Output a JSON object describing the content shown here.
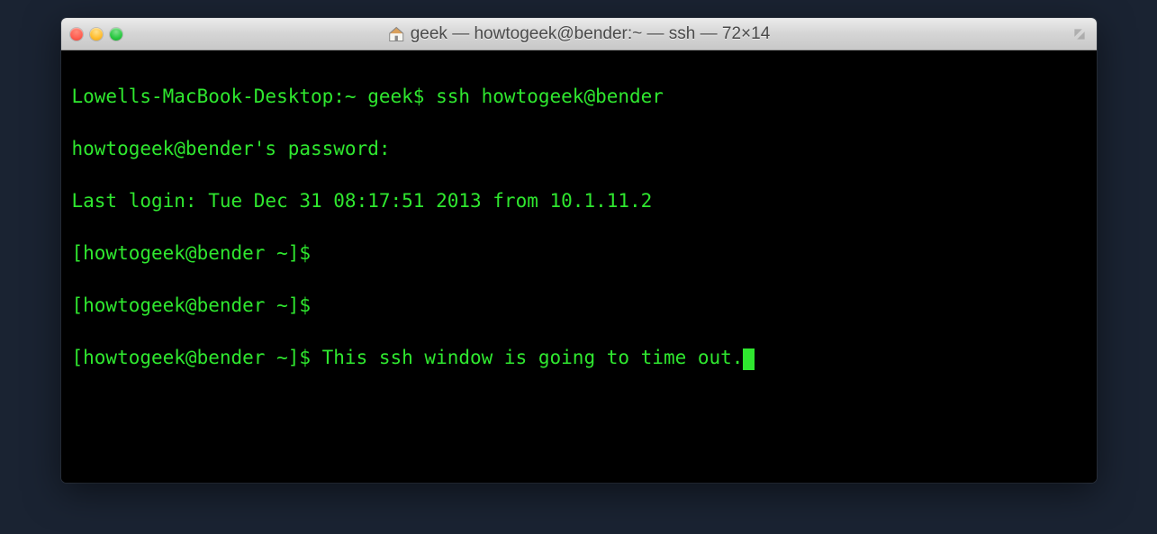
{
  "window": {
    "title": "geek — howtogeek@bender:~ — ssh — 72×14"
  },
  "terminal": {
    "lines": [
      "Lowells-MacBook-Desktop:~ geek$ ssh howtogeek@bender",
      "howtogeek@bender's password:",
      "Last login: Tue Dec 31 08:17:51 2013 from 10.1.11.2",
      "[howtogeek@bender ~]$",
      "[howtogeek@bender ~]$",
      "[howtogeek@bender ~]$ This ssh window is going to time out."
    ]
  },
  "colors": {
    "terminal_bg": "#000000",
    "terminal_fg": "#2fe72f"
  }
}
